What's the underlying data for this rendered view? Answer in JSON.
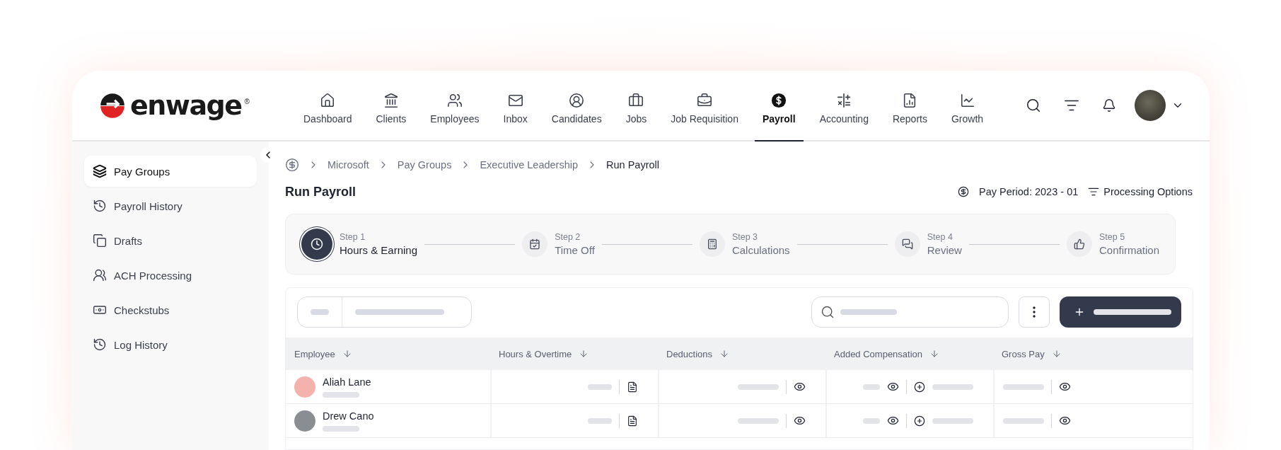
{
  "logo": {
    "text": "enwage",
    "mark": "®"
  },
  "nav": [
    {
      "label": "Dashboard",
      "selected": false
    },
    {
      "label": "Clients",
      "selected": false
    },
    {
      "label": "Employees",
      "selected": false
    },
    {
      "label": "Inbox",
      "selected": false
    },
    {
      "label": "Candidates",
      "selected": false
    },
    {
      "label": "Jobs",
      "selected": false
    },
    {
      "label": "Job Requisition",
      "selected": false
    },
    {
      "label": "Payroll",
      "selected": true
    },
    {
      "label": "Accounting",
      "selected": false
    },
    {
      "label": "Reports",
      "selected": false
    },
    {
      "label": "Growth",
      "selected": false
    }
  ],
  "sidebar": {
    "items": [
      {
        "label": "Pay Groups",
        "selected": true
      },
      {
        "label": "Payroll History",
        "selected": false
      },
      {
        "label": "Drafts",
        "selected": false
      },
      {
        "label": "ACH Processing",
        "selected": false
      },
      {
        "label": "Checkstubs",
        "selected": false
      },
      {
        "label": "Log History",
        "selected": false
      }
    ]
  },
  "breadcrumb": [
    "Microsoft",
    "Pay Groups",
    "Executive Leadership",
    "Run Payroll"
  ],
  "page_title": "Run Payroll",
  "pay_period": "Pay Period: 2023 - 01",
  "processing_options": "Processing Options",
  "steps": [
    {
      "step": "Step 1",
      "label": "Hours & Earning",
      "selected": true
    },
    {
      "step": "Step 2",
      "label": "Time Off",
      "selected": false
    },
    {
      "step": "Step 3",
      "label": "Calculations",
      "selected": false
    },
    {
      "step": "Step 4",
      "label": "Review",
      "selected": false
    },
    {
      "step": "Step 5",
      "label": "Confirmation",
      "selected": false
    }
  ],
  "table": {
    "columns": [
      "Employee",
      "Hours & Overtime",
      "Deductions",
      "Added Compensation",
      "Gross Pay"
    ],
    "rows": [
      {
        "name": "Aliah Lane"
      },
      {
        "name": "Drew Cano"
      }
    ]
  }
}
